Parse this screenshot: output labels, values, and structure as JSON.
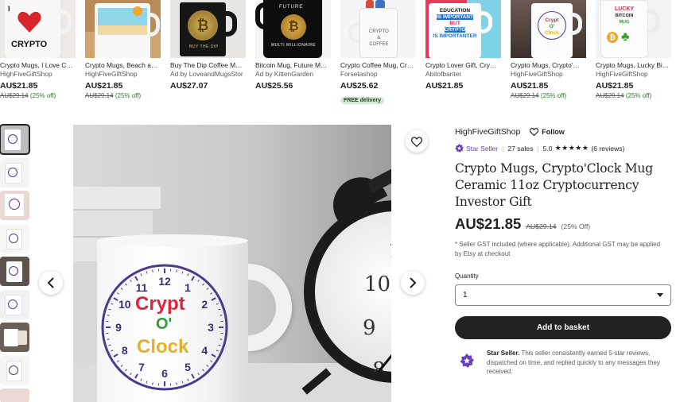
{
  "carousel": [
    {
      "title": "Crypto Mugs, I Love C…",
      "shop": "HighFiveGiftShop",
      "price": "AU$21.85",
      "orig": "AU$29.14",
      "off": "(25% off)",
      "image_text": "I CRYPTO"
    },
    {
      "title": "Crypto Mugs, Beach a…",
      "shop": "HighFiveGiftShop",
      "price": "AU$21.85",
      "orig": "AU$29.14",
      "off": "(25% off)"
    },
    {
      "title": "Buy The Dip Coffee M…",
      "shop": "Ad by LoveandMugsStor",
      "price": "AU$27.07",
      "image_text": "BUY THE DIP"
    },
    {
      "title": "Bitcoin Mug, Future M…",
      "shop": "Ad by KittenGarden",
      "price": "AU$25.56",
      "image_text": "FUTURE MULTI MILLIONAIRE"
    },
    {
      "title": "Crypto Coffee Mug, Cr…",
      "shop": "Forsetashop",
      "price": "AU$25.62",
      "badge": "FREE delivery",
      "image_text": "CRYPTO & COFFEE"
    },
    {
      "title": "Crypto Lover Gift, Cry…",
      "shop": "Abitofbanter",
      "price": "AU$21.85",
      "image_text": "EDUCATION IS IMPORTANT BUT CRYPTO IS IMPORTANTER"
    },
    {
      "title": "Crypto Mugs, Crypto'…",
      "shop": "HighFiveGiftShop",
      "price": "AU$21.85",
      "orig": "AU$29.14",
      "off": "(25% off)",
      "image_text": "Crypt O' Clock"
    },
    {
      "title": "Crypto Mugs, Lucky Bi…",
      "shop": "HighFiveGiftShop",
      "price": "AU$21.85",
      "orig": "AU$29.14",
      "off": "(25% off)",
      "image_text": "LUCKY BITCOIN MUG"
    }
  ],
  "product": {
    "shop_name": "HighFiveGiftShop",
    "follow_label": "Follow",
    "star_seller": "Star Seller",
    "sales": "27 sales",
    "rating": "5.0",
    "stars": "★★★★★",
    "reviews": "(6 reviews)",
    "title": "Crypto Mugs, Crypto'Clock Mug Ceramic 11oz Cryptocurrency Investor Gift",
    "price": "AU$21.85",
    "orig_price": "AU$29.14",
    "discount": "(25% Off)",
    "gst_note": "* Seller GST included (where applicable). Additional GST may be applied by Etsy at checkout",
    "quantity_label": "Quantity",
    "quantity_value": "1",
    "basket_label": "Add to basket",
    "star_seller_title": "Star Seller.",
    "star_seller_text": " This seller consistently earned 5-star reviews, dispatched on time, and replied quickly to any messages they received."
  },
  "mug_text": {
    "line1": "Crypt",
    "line2": "O'",
    "line3": "Clock"
  },
  "clock_numbers": [
    "12",
    "1",
    "2",
    "3",
    "4",
    "5",
    "6",
    "7",
    "8",
    "9",
    "10",
    "11"
  ],
  "colors": {
    "star_seller": "#6a3ec4",
    "discount_green": "#2a7a2a",
    "button": "#222222",
    "clock_purple": "#4b3a8c"
  }
}
